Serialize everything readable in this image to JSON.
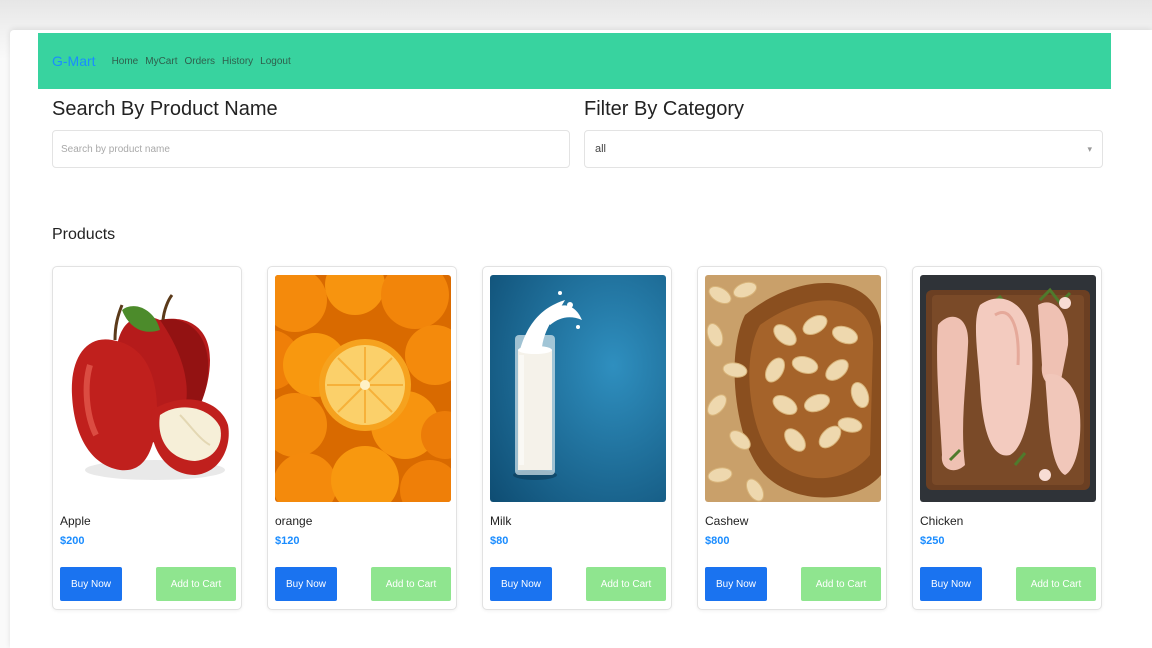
{
  "navbar": {
    "brand": "G-Mart",
    "links": [
      "Home",
      "MyCart",
      "Orders",
      "History",
      "Logout"
    ]
  },
  "search": {
    "title": "Search By Product Name",
    "placeholder": "Search by product name",
    "value": ""
  },
  "filter": {
    "title": "Filter By Category",
    "selected": "all"
  },
  "products_section": {
    "title": "Products",
    "items": [
      {
        "name": "Apple",
        "price": "$200",
        "buy_label": "Buy Now",
        "cart_label": "Add to Cart",
        "image": "apple-image"
      },
      {
        "name": "orange",
        "price": "$120",
        "buy_label": "Buy Now",
        "cart_label": "Add to Cart",
        "image": "orange-image"
      },
      {
        "name": "Milk",
        "price": "$80",
        "buy_label": "Buy Now",
        "cart_label": "Add to Cart",
        "image": "milk-image"
      },
      {
        "name": "Cashew",
        "price": "$800",
        "buy_label": "Buy Now",
        "cart_label": "Add to Cart",
        "image": "cashew-image"
      },
      {
        "name": "Chicken",
        "price": "$250",
        "buy_label": "Buy Now",
        "cart_label": "Add to Cart",
        "image": "chicken-image"
      }
    ]
  },
  "colors": {
    "navbar": "#38d39f",
    "brand": "#1a8cff",
    "buy_button": "#1a73f0",
    "cart_button": "#8fe58f",
    "price": "#1a8cff"
  }
}
